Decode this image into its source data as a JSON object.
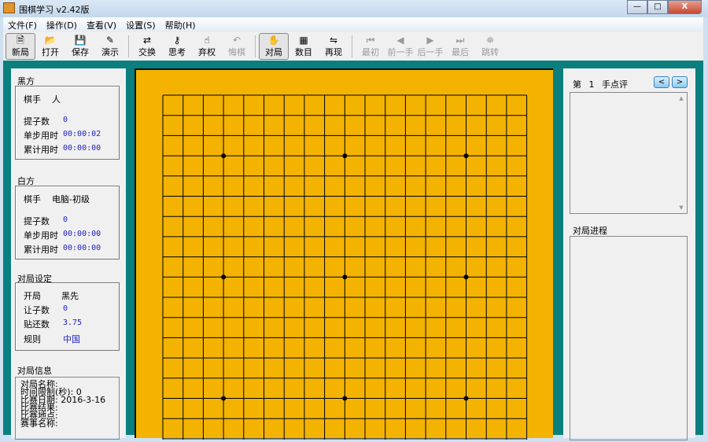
{
  "window": {
    "title": "围棋学习 v2.42版",
    "minimize": "—",
    "maximize": "□",
    "close": "X"
  },
  "menu": [
    "文件(F)",
    "操作(D)",
    "查看(V)",
    "设置(S)",
    "帮助(H)"
  ],
  "toolbar": [
    {
      "label": "新局",
      "icon": "new-file-icon",
      "glyph": "🗎",
      "state": "active"
    },
    {
      "label": "打开",
      "icon": "open-folder-icon",
      "glyph": "📂",
      "state": "normal"
    },
    {
      "label": "保存",
      "icon": "save-disk-icon",
      "glyph": "💾",
      "state": "normal"
    },
    {
      "label": "演示",
      "icon": "demo-icon",
      "glyph": "✎",
      "state": "normal"
    },
    {
      "sep": true
    },
    {
      "label": "交换",
      "icon": "swap-icon",
      "glyph": "⇄",
      "state": "normal"
    },
    {
      "label": "思考",
      "icon": "key-icon",
      "glyph": "⚷",
      "state": "normal"
    },
    {
      "label": "弃权",
      "icon": "hand-pass-icon",
      "glyph": "☝",
      "state": "normal"
    },
    {
      "label": "悔棋",
      "icon": "undo-icon",
      "glyph": "↶",
      "state": "disabled"
    },
    {
      "sep": true
    },
    {
      "label": "对局",
      "icon": "play-hand-icon",
      "glyph": "✋",
      "state": "active"
    },
    {
      "label": "数目",
      "icon": "count-grid-icon",
      "glyph": "▦",
      "state": "normal"
    },
    {
      "label": "再现",
      "icon": "replay-icon",
      "glyph": "⇋",
      "state": "normal"
    },
    {
      "sep": true
    },
    {
      "label": "最初",
      "icon": "first-icon",
      "glyph": "⏮",
      "state": "disabled"
    },
    {
      "label": "前一手",
      "icon": "prev-icon",
      "glyph": "◀",
      "state": "disabled"
    },
    {
      "label": "后一手",
      "icon": "next-icon",
      "glyph": "▶",
      "state": "disabled"
    },
    {
      "label": "最后",
      "icon": "last-icon",
      "glyph": "⏭",
      "state": "disabled"
    },
    {
      "label": "跳转",
      "icon": "binoculars-icon",
      "glyph": "⛯",
      "state": "disabled"
    }
  ],
  "black": {
    "title": "黑方",
    "player_label": "棋手",
    "player": "人",
    "captures_label": "提子数",
    "captures": "0",
    "step_time_label": "单步用时",
    "step_time": "00:00:02",
    "total_time_label": "累计用时",
    "total_time": "00:00:00"
  },
  "white": {
    "title": "白方",
    "player_label": "棋手",
    "player": "电脑-初级",
    "captures_label": "提子数",
    "captures": "0",
    "step_time_label": "单步用时",
    "step_time": "00:00:00",
    "total_time_label": "累计用时",
    "total_time": "00:00:00"
  },
  "settings": {
    "title": "对局设定",
    "opening_label": "开局",
    "opening": "黑先",
    "handicap_label": "让子数",
    "handicap": "0",
    "komi_label": "贴还数",
    "komi": "3.75",
    "rules_label": "规则",
    "rules": "中国"
  },
  "info": {
    "title": "对局信息",
    "lines": [
      "对局名称:",
      "时间限制(秒): 0",
      "比赛日期: 2016-3-16",
      "比赛结果:",
      "比赛地点:",
      "赛事名称:"
    ]
  },
  "comment": {
    "prefix": "第",
    "move": "1",
    "suffix": "手点评",
    "prev": "<",
    "next": ">"
  },
  "progress": {
    "title": "对局进程"
  },
  "board": {
    "size": 19,
    "stars": [
      [
        3,
        3
      ],
      [
        3,
        9
      ],
      [
        3,
        15
      ],
      [
        9,
        3
      ],
      [
        9,
        9
      ],
      [
        9,
        15
      ],
      [
        15,
        3
      ],
      [
        15,
        9
      ],
      [
        15,
        15
      ]
    ]
  }
}
